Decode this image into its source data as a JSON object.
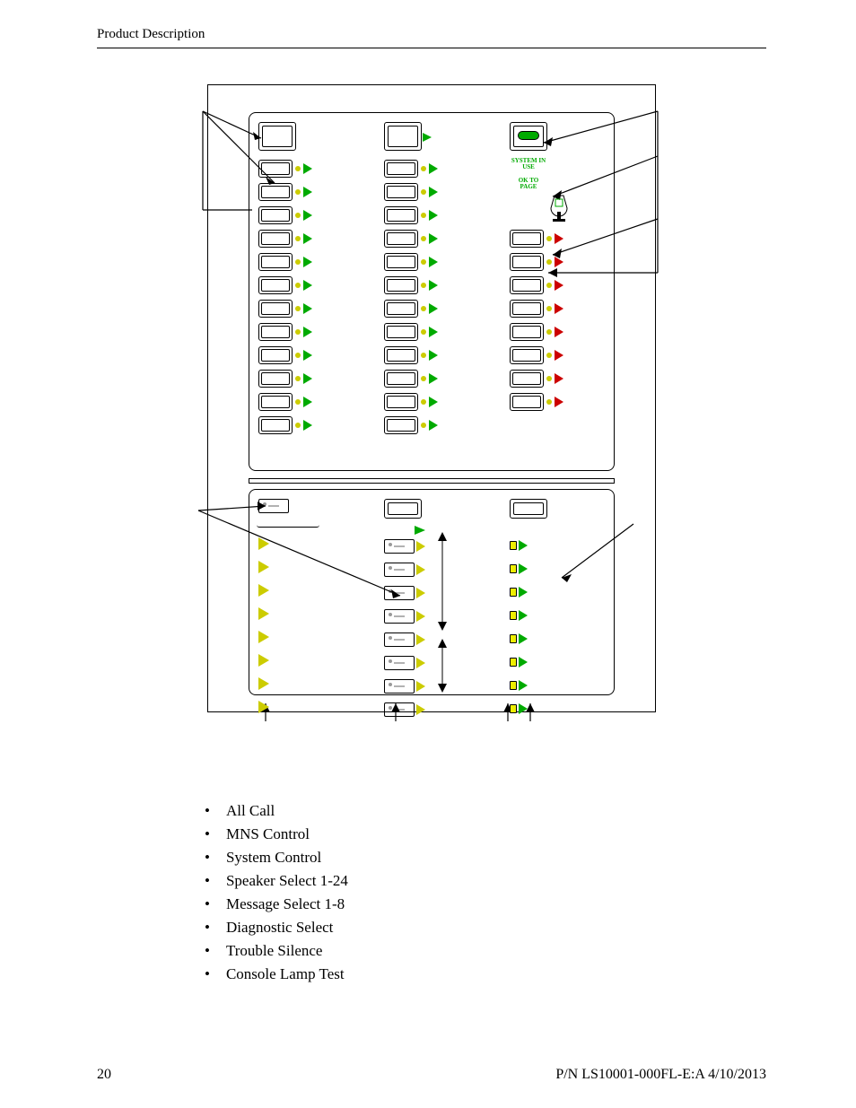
{
  "header": {
    "title": "Product Description"
  },
  "diagram": {
    "status_labels": {
      "system_in_use": "SYSTEM IN USE",
      "ok_to_page": "OK TO PAGE"
    },
    "top_panel": {
      "columns": [
        {
          "big_button": true,
          "rows": 12,
          "arrow_color": "green"
        },
        {
          "big_button": true,
          "rows": 12,
          "arrow_color": "green"
        },
        {
          "big_button_led": "green",
          "status": true,
          "rows": 8,
          "arrow_color": "red"
        }
      ]
    },
    "bottom_panel": {
      "columns": [
        {
          "lamp_button": true,
          "rows": 8,
          "row_style": "yellow_triangle"
        },
        {
          "big_button": true,
          "rows": 8,
          "row_style": "lamp_yellow",
          "double_arrow_rows": [
            1,
            5
          ],
          "double_arrow2_rows": [
            6,
            8
          ]
        },
        {
          "big_button": true,
          "rows": 8,
          "row_style": "yled_green"
        }
      ]
    }
  },
  "bullets": [
    "All Call",
    "MNS Control",
    "System Control",
    "Speaker Select 1-24",
    "Message Select 1-8",
    "Diagnostic Select",
    "Trouble Silence",
    "Console Lamp Test"
  ],
  "footer": {
    "page_number": "20",
    "doc_id": "P/N LS10001-000FL-E:A  4/10/2013"
  }
}
